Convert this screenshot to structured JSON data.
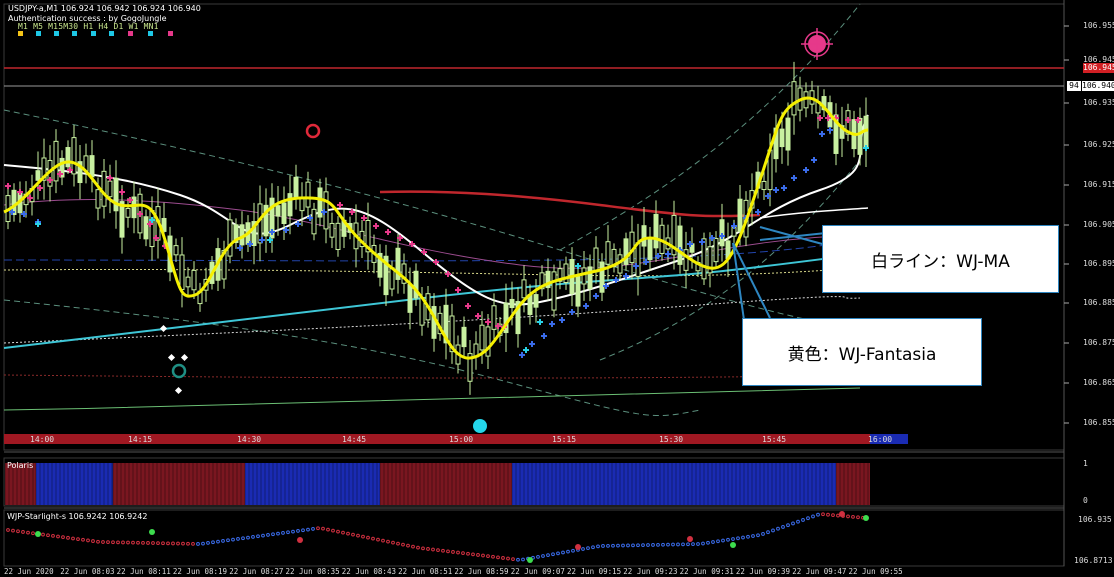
{
  "header": {
    "symbol_line": "USDJPY-a,M1  106.924 106.942 106.924 106.940",
    "auth_line": "Authentication success : by GogoJungle"
  },
  "timeframes": [
    "M1",
    "M5",
    "M15",
    "M30",
    "H1",
    "H4",
    "D1",
    "W1",
    "MN1"
  ],
  "timeframe_dot_colors": [
    "#f5c518",
    "#1ec8e6",
    "#1ec8e6",
    "#1ec8e6",
    "#1ec8e6",
    "#1ec8e6",
    "#e6398a",
    "#1ec8e6",
    "#e6398a"
  ],
  "price_axis": {
    "labels": [
      "106.955",
      "106.945",
      "106.935",
      "106.925",
      "106.915",
      "106.905",
      "106.895",
      "106.885",
      "106.875",
      "106.865",
      "106.855"
    ],
    "resistance_tag": "106.945",
    "current_price_tag": "106.940",
    "current_price_prefix": "94"
  },
  "upper_time_axis": {
    "labels": [
      "14:00",
      "14:15",
      "14:30",
      "14:45",
      "15:00",
      "15:15",
      "15:30",
      "15:45",
      "16:00"
    ]
  },
  "polaris": {
    "title": "Polaris",
    "scale_top": "1",
    "scale_bottom": "0"
  },
  "starlight": {
    "title": "WJP-Starlight-s 106.9242 106.9242",
    "scale_top": "106.935",
    "scale_bottom": "106.8713"
  },
  "bottom_time_axis": {
    "labels": [
      "22 Jun 2020",
      "22 Jun 08:03",
      "22 Jun 08:11",
      "22 Jun 08:19",
      "22 Jun 08:27",
      "22 Jun 08:35",
      "22 Jun 08:43",
      "22 Jun 08:51",
      "22 Jun 08:59",
      "22 Jun 09:07",
      "22 Jun 09:15",
      "22 Jun 09:23",
      "22 Jun 09:31",
      "22 Jun 09:39",
      "22 Jun 09:47",
      "22 Jun 09:55"
    ]
  },
  "annotations": {
    "white_line": "白ライン：WJ-MA",
    "yellow_line": "黄色：WJ-Fantasia"
  },
  "colors": {
    "yellow_line": "#f5f000",
    "white_line": "#ffffff",
    "ma_red": "#c0272d",
    "cyan_line": "#3ec6d6",
    "candle": "#c8f0a0",
    "annotation_border": "#2e86c1"
  }
}
